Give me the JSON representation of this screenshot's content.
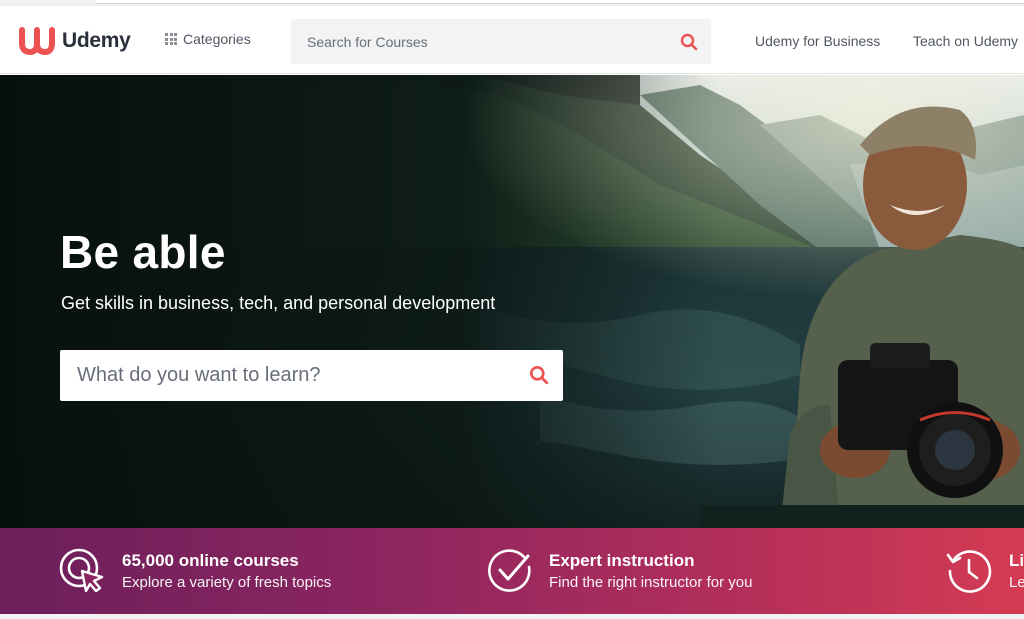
{
  "header": {
    "logo_text": "Udemy",
    "categories_label": "Categories",
    "search_placeholder": "Search for Courses",
    "nav": {
      "business": "Udemy for Business",
      "teach": "Teach on Udemy"
    }
  },
  "hero": {
    "title": "Be able",
    "subtitle": "Get skills in business, tech, and personal development",
    "search_placeholder": "What do you want to learn?"
  },
  "features": [
    {
      "title": "65,000 online courses",
      "subtitle": "Explore a variety of fresh topics",
      "icon": "target-cursor-icon"
    },
    {
      "title": "Expert instruction",
      "subtitle": "Find the right instructor for you",
      "icon": "check-badge-icon"
    },
    {
      "title": "Li",
      "subtitle": "Le",
      "icon": "history-clock-icon"
    }
  ],
  "colors": {
    "brand": "#ec5252",
    "band_start": "#6b1f5a",
    "band_end": "#d43b53",
    "text_dark": "#29303b"
  }
}
